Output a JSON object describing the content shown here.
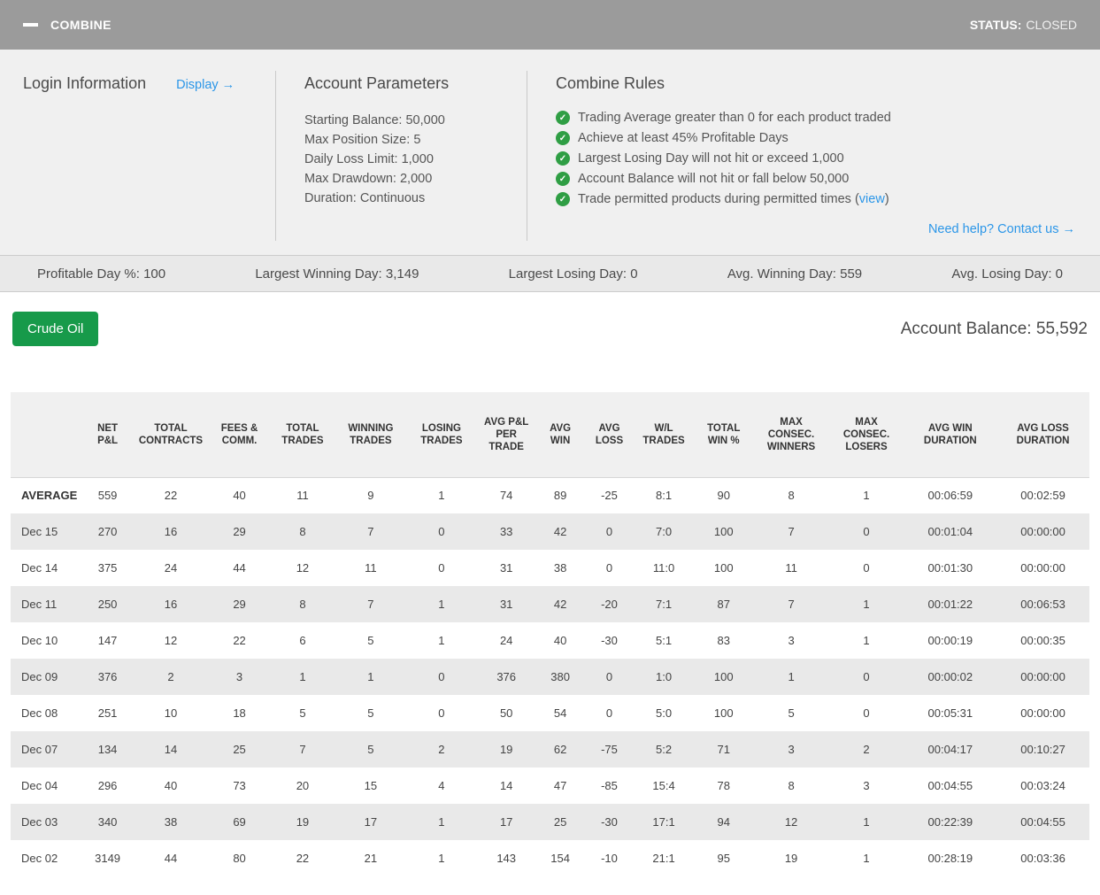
{
  "header": {
    "title": "COMBINE",
    "status_label": "STATUS:",
    "status_value": "CLOSED"
  },
  "panel": {
    "login": {
      "title": "Login Information",
      "display_link": "Display →"
    },
    "parameters": {
      "title": "Account Parameters",
      "items": [
        {
          "label": "Starting Balance:",
          "value": "50,000"
        },
        {
          "label": "Max Position Size:",
          "value": "5"
        },
        {
          "label": "Daily Loss Limit:",
          "value": "1,000"
        },
        {
          "label": "Max Drawdown:",
          "value": "2,000"
        },
        {
          "label": "Duration:",
          "value": "Continuous"
        }
      ]
    },
    "rules": {
      "title": "Combine Rules",
      "items": [
        {
          "text": "Trading Average greater than 0 for each product traded",
          "link": "",
          "after": ""
        },
        {
          "text": "Achieve at least 45% Profitable Days",
          "link": "",
          "after": ""
        },
        {
          "text": "Largest Losing Day will not hit or exceed 1,000",
          "link": "",
          "after": ""
        },
        {
          "text": "Account Balance will not hit or fall below 50,000",
          "link": "",
          "after": ""
        },
        {
          "text": "Trade permitted products during permitted times (",
          "link": "view",
          "after": ")"
        }
      ],
      "help_link": "Need help? Contact us →"
    }
  },
  "stats": [
    {
      "label": "Profitable Day %:",
      "value": "100"
    },
    {
      "label": "Largest Winning Day:",
      "value": "3,149"
    },
    {
      "label": "Largest Losing Day:",
      "value": "0"
    },
    {
      "label": "Avg. Winning Day:",
      "value": "559"
    },
    {
      "label": "Avg. Losing Day:",
      "value": "0"
    }
  ],
  "product": {
    "button_label": "Crude Oil"
  },
  "account_balance": {
    "label": "Account Balance:",
    "value": "55,592"
  },
  "table": {
    "columns": [
      "",
      "NET P&L",
      "TOTAL CONTRACTS",
      "FEES & COMM.",
      "TOTAL TRADES",
      "WINNING TRADES",
      "LOSING TRADES",
      "AVG P&L PER TRADE",
      "AVG WIN",
      "AVG LOSS",
      "W/L TRADES",
      "TOTAL WIN %",
      "MAX CONSEC. WINNERS",
      "MAX CONSEC. LOSERS",
      "AVG WIN DURATION",
      "AVG LOSS DURATION"
    ],
    "rows": [
      {
        "label": "AVERAGE",
        "values": [
          "559",
          "22",
          "40",
          "11",
          "9",
          "1",
          "74",
          "89",
          "-25",
          "8:1",
          "90",
          "8",
          "1",
          "00:06:59",
          "00:02:59"
        ]
      },
      {
        "label": "Dec 15",
        "values": [
          "270",
          "16",
          "29",
          "8",
          "7",
          "0",
          "33",
          "42",
          "0",
          "7:0",
          "100",
          "7",
          "0",
          "00:01:04",
          "00:00:00"
        ]
      },
      {
        "label": "Dec 14",
        "values": [
          "375",
          "24",
          "44",
          "12",
          "11",
          "0",
          "31",
          "38",
          "0",
          "11:0",
          "100",
          "11",
          "0",
          "00:01:30",
          "00:00:00"
        ]
      },
      {
        "label": "Dec 11",
        "values": [
          "250",
          "16",
          "29",
          "8",
          "7",
          "1",
          "31",
          "42",
          "-20",
          "7:1",
          "87",
          "7",
          "1",
          "00:01:22",
          "00:06:53"
        ]
      },
      {
        "label": "Dec 10",
        "values": [
          "147",
          "12",
          "22",
          "6",
          "5",
          "1",
          "24",
          "40",
          "-30",
          "5:1",
          "83",
          "3",
          "1",
          "00:00:19",
          "00:00:35"
        ]
      },
      {
        "label": "Dec 09",
        "values": [
          "376",
          "2",
          "3",
          "1",
          "1",
          "0",
          "376",
          "380",
          "0",
          "1:0",
          "100",
          "1",
          "0",
          "00:00:02",
          "00:00:00"
        ]
      },
      {
        "label": "Dec 08",
        "values": [
          "251",
          "10",
          "18",
          "5",
          "5",
          "0",
          "50",
          "54",
          "0",
          "5:0",
          "100",
          "5",
          "0",
          "00:05:31",
          "00:00:00"
        ]
      },
      {
        "label": "Dec 07",
        "values": [
          "134",
          "14",
          "25",
          "7",
          "5",
          "2",
          "19",
          "62",
          "-75",
          "5:2",
          "71",
          "3",
          "2",
          "00:04:17",
          "00:10:27"
        ]
      },
      {
        "label": "Dec 04",
        "values": [
          "296",
          "40",
          "73",
          "20",
          "15",
          "4",
          "14",
          "47",
          "-85",
          "15:4",
          "78",
          "8",
          "3",
          "00:04:55",
          "00:03:24"
        ]
      },
      {
        "label": "Dec 03",
        "values": [
          "340",
          "38",
          "69",
          "19",
          "17",
          "1",
          "17",
          "25",
          "-30",
          "17:1",
          "94",
          "12",
          "1",
          "00:22:39",
          "00:04:55"
        ]
      },
      {
        "label": "Dec 02",
        "values": [
          "3149",
          "44",
          "80",
          "22",
          "21",
          "1",
          "143",
          "154",
          "-10",
          "21:1",
          "95",
          "19",
          "1",
          "00:28:19",
          "00:03:36"
        ]
      }
    ]
  }
}
